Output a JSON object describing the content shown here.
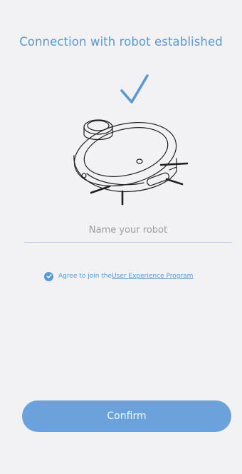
{
  "header": {
    "title": "Connection with robot established"
  },
  "status": {
    "icon": "check-icon"
  },
  "illustration": {
    "icon": "robot-vacuum-icon"
  },
  "name_field": {
    "placeholder": "Name your robot",
    "value": ""
  },
  "agreement": {
    "checked": true,
    "text": "Agree to join the",
    "link_text": "User Experience Program"
  },
  "actions": {
    "confirm_label": "Confirm"
  },
  "colors": {
    "accent": "#5a99d4",
    "button": "#6ba2db",
    "background": "#f2f2f4"
  }
}
